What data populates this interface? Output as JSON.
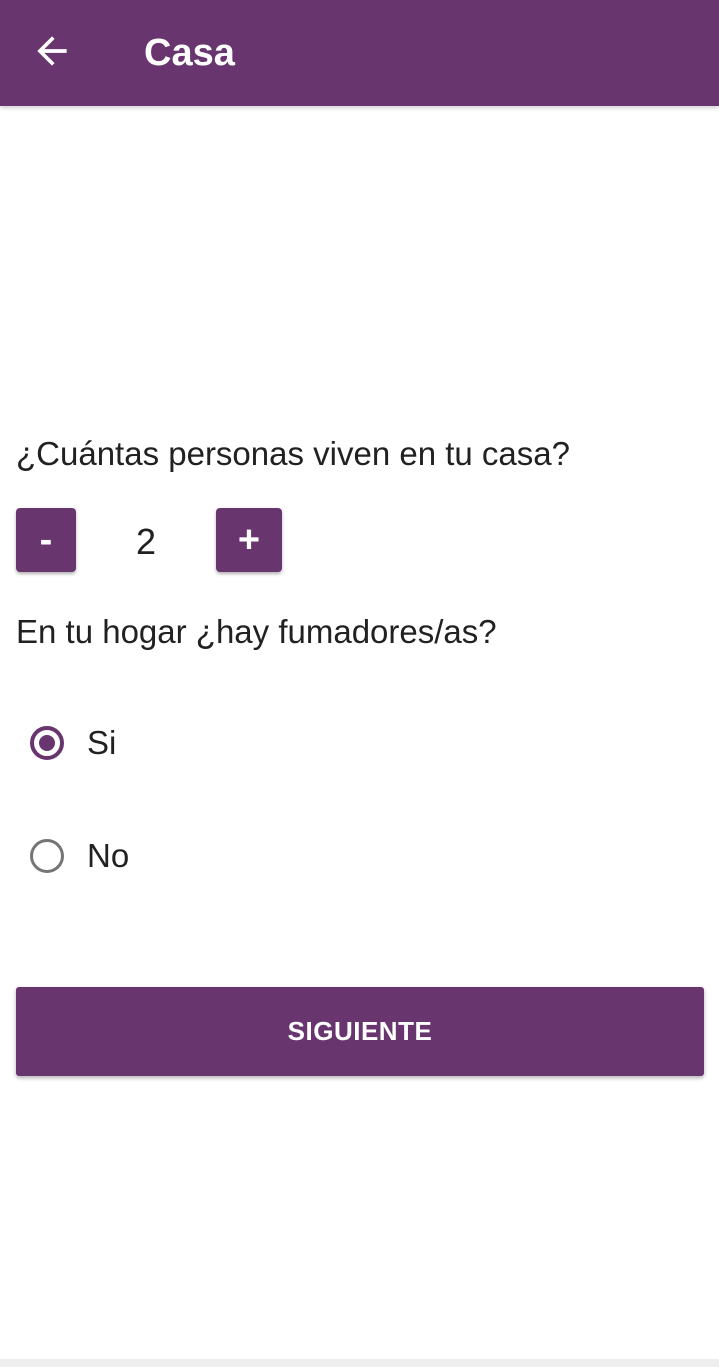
{
  "app_bar": {
    "title": "Casa",
    "back_icon": "arrow-left-icon",
    "color": "#68356e"
  },
  "form": {
    "people_question": "¿Cuántas personas viven en tu casa?",
    "stepper": {
      "decrement_label": "-",
      "increment_label": "+",
      "value": "2"
    },
    "smokers_question": "En tu hogar ¿hay fumadores/as?",
    "smokers_options": [
      {
        "label": "Si",
        "selected": true
      },
      {
        "label": "No",
        "selected": false
      }
    ]
  },
  "actions": {
    "next_label": "SIGUIENTE"
  },
  "colors": {
    "accent": "#68356e",
    "text": "#212121",
    "radio_unchecked": "#757575"
  }
}
